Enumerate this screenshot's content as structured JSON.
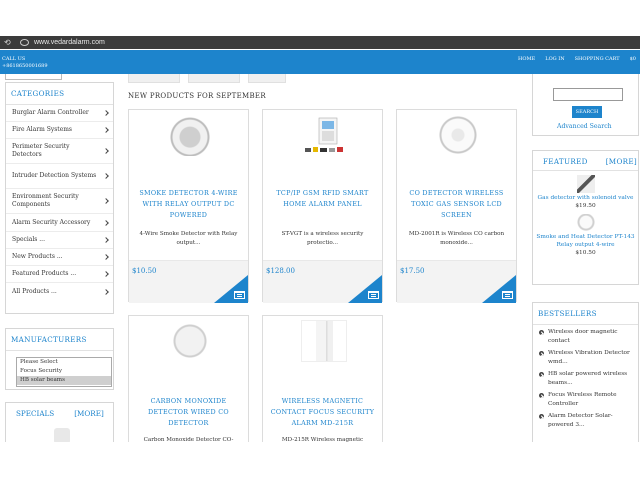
{
  "browser": {
    "url": "www.vedardalarm.com"
  },
  "topbar": {
    "call_label": "CALL US",
    "phone": "+8618650001689",
    "links": [
      "HOME",
      "LOG IN",
      "SHOPPING CART",
      "$0"
    ]
  },
  "categories": {
    "title": "CATEGORIES",
    "items": [
      "Burglar Alarm Controller",
      "Fire Alarm Systems",
      "Perimeter Security Detectors",
      "Intruder Detection Systems",
      "Environment Security Components",
      "Alarm Security Accessory",
      "Specials ...",
      "New Products ...",
      "Featured Products ...",
      "All Products ..."
    ]
  },
  "manufacturers": {
    "title": "MANUFACTURERS",
    "options": [
      "Please Select",
      "Focus Security",
      "HB solar beams"
    ],
    "selected_index": 2
  },
  "specials": {
    "title": "SPECIALS",
    "more": "[MORE]"
  },
  "main": {
    "heading": "NEW PRODUCTS FOR SEPTEMBER",
    "products": [
      {
        "title": "SMOKE DETECTOR 4-WIRE WITH RELAY OUTPUT DC POWERED",
        "desc": "4-Wire Smoke Detector with Relay output...",
        "price": "$10.50"
      },
      {
        "title": "TCP/IP GSM RFID SMART HOME ALARM PANEL",
        "desc": "ST-VGT is a wireless security protectio...",
        "price": "$128.00"
      },
      {
        "title": "CO DETECTOR WIRELESS TOXIC GAS SENSOR LCD SCREEN",
        "desc": "MD-2001R is Wireless CO carbon monoxide...",
        "price": "$17.50"
      },
      {
        "title": "CARBON MONOXIDE DETECTOR WIRED CO DETECTOR",
        "desc": "Carbon Monoxide Detector CO-",
        "price": ""
      },
      {
        "title": "WIRELESS MAGNETIC CONTACT FOCUS SECURITY ALARM MD-215R",
        "desc": "MD-215R Wireless magnetic",
        "price": ""
      }
    ]
  },
  "search": {
    "button": "SEARCH",
    "advanced": "Advanced Search"
  },
  "featured": {
    "title": "FEATURED",
    "more": "[MORE]",
    "items": [
      {
        "name": "Gas detector with solenoid valve",
        "price": "$19.50"
      },
      {
        "name": "Smoke and Heat Detector PT-143 Relay output 4-wire",
        "price": "$10.50"
      }
    ]
  },
  "bestsellers": {
    "title": "BESTSELLERS",
    "items": [
      "Wireless door magnetic contact",
      "Wireless Vibration Detector wmd...",
      "HB solar powered wireless beams...",
      "Focus Wireless Remote Controller",
      "Alarm Detector Solar-powered 3..."
    ]
  },
  "colors": {
    "brand": "#1d84cc",
    "urlbar": "#3b3b3b"
  }
}
